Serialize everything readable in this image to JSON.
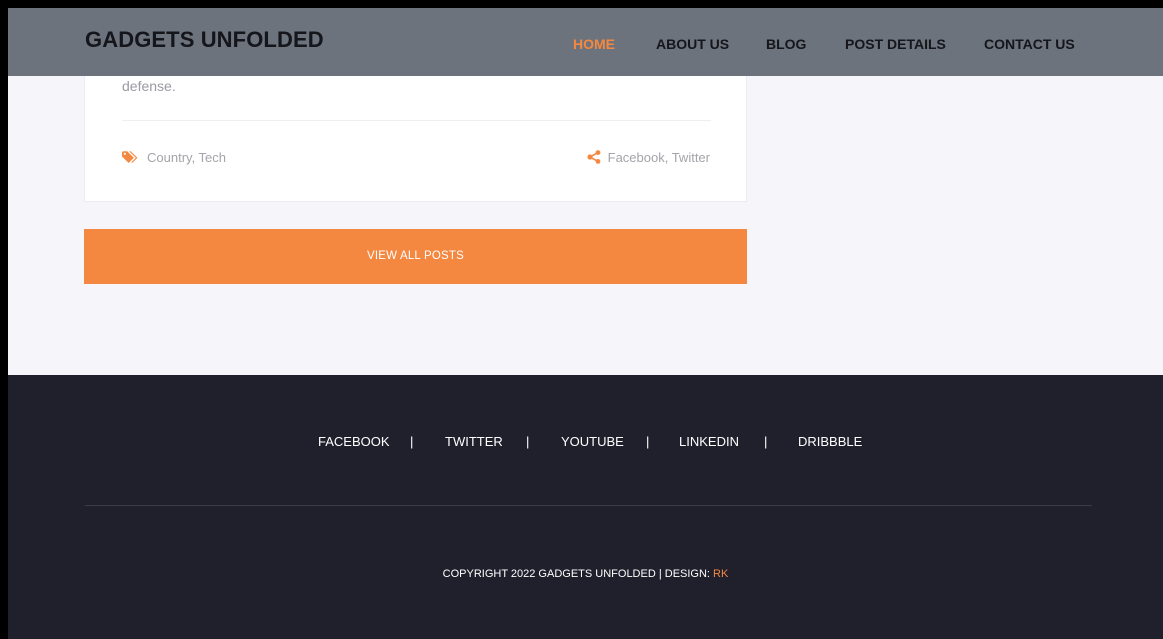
{
  "header": {
    "brand": "GADGETS UNFOLDED",
    "nav": [
      {
        "label": "HOME",
        "active": true
      },
      {
        "label": "ABOUT US",
        "active": false
      },
      {
        "label": "BLOG",
        "active": false
      },
      {
        "label": "POST DETAILS",
        "active": false
      },
      {
        "label": "CONTACT US",
        "active": false
      }
    ]
  },
  "post": {
    "excerpt": "defense.",
    "tags_icon": "tags-icon",
    "tags": "Country, Tech",
    "share_icon": "share-icon",
    "share": "Facebook, Twitter"
  },
  "view_all_label": "VIEW ALL POSTS",
  "footer": {
    "social": [
      "FACEBOOK",
      "TWITTER",
      "YOUTUBE",
      "LINKEDIN",
      "DRIBBBLE"
    ],
    "separator": "|",
    "copyright_prefix": "COPYRIGHT 2022 GADGETS UNFOLDED | DESIGN: ",
    "designer": "RK"
  },
  "colors": {
    "accent": "#f48840",
    "header_bg": "#6c737c",
    "footer_bg": "#20202d",
    "page_bg": "#f6f5fa"
  }
}
